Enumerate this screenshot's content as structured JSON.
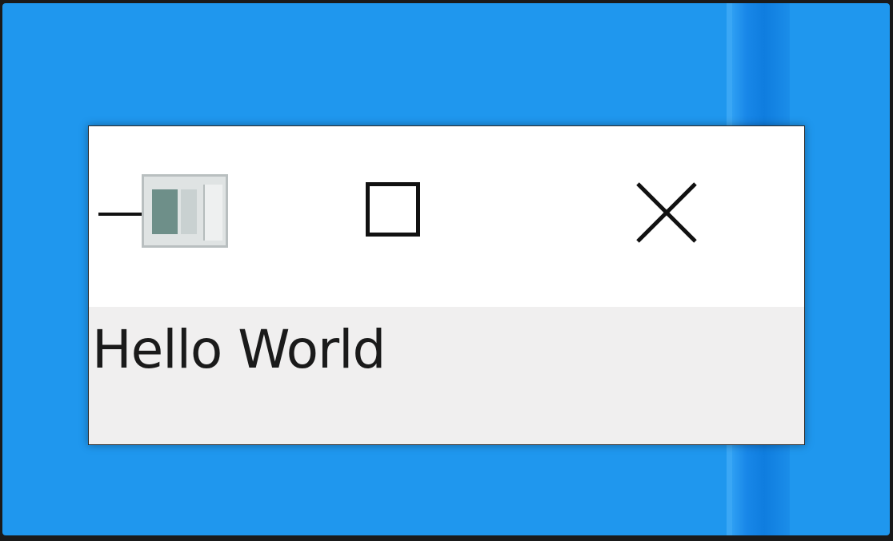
{
  "desktop": {
    "background_color": "#1f97ee"
  },
  "window": {
    "app_icon": "app-window-icon",
    "controls": {
      "minimize_icon": "minimize-icon",
      "maximize_icon": "maximize-icon",
      "close_icon": "close-icon"
    },
    "content": {
      "label_text": "Hello World"
    }
  }
}
